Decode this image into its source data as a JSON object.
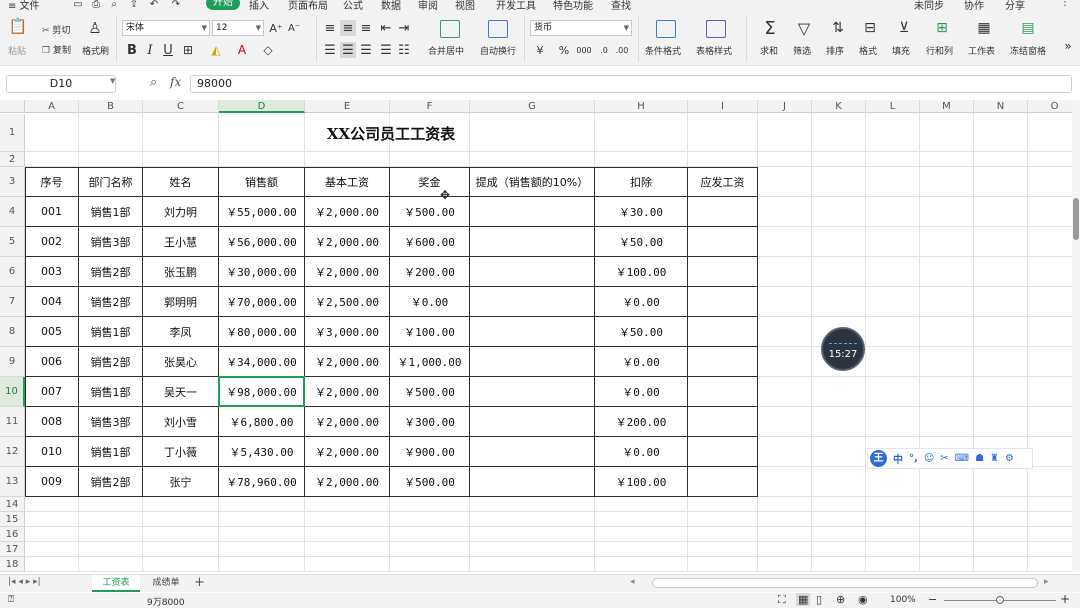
{
  "menu": {
    "items": [
      "≡ 文件",
      "开始",
      "插入",
      "页面布局",
      "公式",
      "数据",
      "审阅",
      "视图",
      "开发工具",
      "特色功能",
      "查找"
    ],
    "active": "开始",
    "right": [
      "未同步",
      "协作",
      "分享"
    ]
  },
  "ribbon": {
    "paste": "粘贴",
    "cut": "剪切",
    "copy": "复制",
    "format_painter": "格式刷",
    "font_name": "宋体",
    "font_size": "12",
    "merge_center": "合并居中",
    "wrap_text": "自动换行",
    "number_format": "货币",
    "conditional_format": "条件格式",
    "table_style": "表格样式",
    "sum": "求和",
    "filter": "筛选",
    "sort": "排序",
    "format": "格式",
    "fill": "填充",
    "row_col": "行和列",
    "worksheet": "工作表",
    "freeze": "冻结窗格"
  },
  "formula_bar": {
    "name_box": "D10",
    "fx_label": "fx",
    "formula": "98000"
  },
  "columns": [
    "A",
    "B",
    "C",
    "D",
    "E",
    "F",
    "G",
    "H",
    "I",
    "J",
    "K",
    "L",
    "M",
    "N",
    "O"
  ],
  "rows": [
    "1",
    "2",
    "3",
    "4",
    "5",
    "6",
    "7",
    "8",
    "9",
    "10",
    "11",
    "12",
    "13",
    "14",
    "15",
    "16",
    "17",
    "18"
  ],
  "sheet": {
    "title": "XX公司员工工资表",
    "headers": [
      "序号",
      "部门名称",
      "姓名",
      "销售额",
      "基本工资",
      "奖金",
      "提成（销售额的10%）",
      "扣除",
      "应发工资"
    ],
    "rows": [
      [
        "001",
        "销售1部",
        "刘力明",
        "￥55,000.00",
        "￥2,000.00",
        "￥500.00",
        "",
        "￥30.00",
        ""
      ],
      [
        "002",
        "销售3部",
        "王小慧",
        "￥56,000.00",
        "￥2,000.00",
        "￥600.00",
        "",
        "￥50.00",
        ""
      ],
      [
        "003",
        "销售2部",
        "张玉鹏",
        "￥30,000.00",
        "￥2,000.00",
        "￥200.00",
        "",
        "￥100.00",
        ""
      ],
      [
        "004",
        "销售2部",
        "郭明明",
        "￥70,000.00",
        "￥2,500.00",
        "￥0.00",
        "",
        "￥0.00",
        ""
      ],
      [
        "005",
        "销售1部",
        "李凤",
        "￥80,000.00",
        "￥3,000.00",
        "￥100.00",
        "",
        "￥50.00",
        ""
      ],
      [
        "006",
        "销售2部",
        "张昊心",
        "￥34,000.00",
        "￥2,000.00",
        "￥1,000.00",
        "",
        "￥0.00",
        ""
      ],
      [
        "007",
        "销售1部",
        "吴天一",
        "￥98,000.00",
        "￥2,000.00",
        "￥500.00",
        "",
        "￥0.00",
        ""
      ],
      [
        "008",
        "销售3部",
        "刘小雪",
        "￥6,800.00",
        "￥2,000.00",
        "￥300.00",
        "",
        "￥200.00",
        ""
      ],
      [
        "010",
        "销售1部",
        "丁小薇",
        "￥5,430.00",
        "￥2,000.00",
        "￥900.00",
        "",
        "￥0.00",
        ""
      ],
      [
        "009",
        "销售2部",
        "张宁",
        "￥78,960.00",
        "￥2,000.00",
        "￥500.00",
        "",
        "￥100.00",
        ""
      ]
    ]
  },
  "tabs": [
    "工资表",
    "成绩单"
  ],
  "active_tab": "工资表",
  "status": {
    "summary": "9万8000",
    "zoom": "100%"
  },
  "timer": "15:27",
  "ime": "中"
}
